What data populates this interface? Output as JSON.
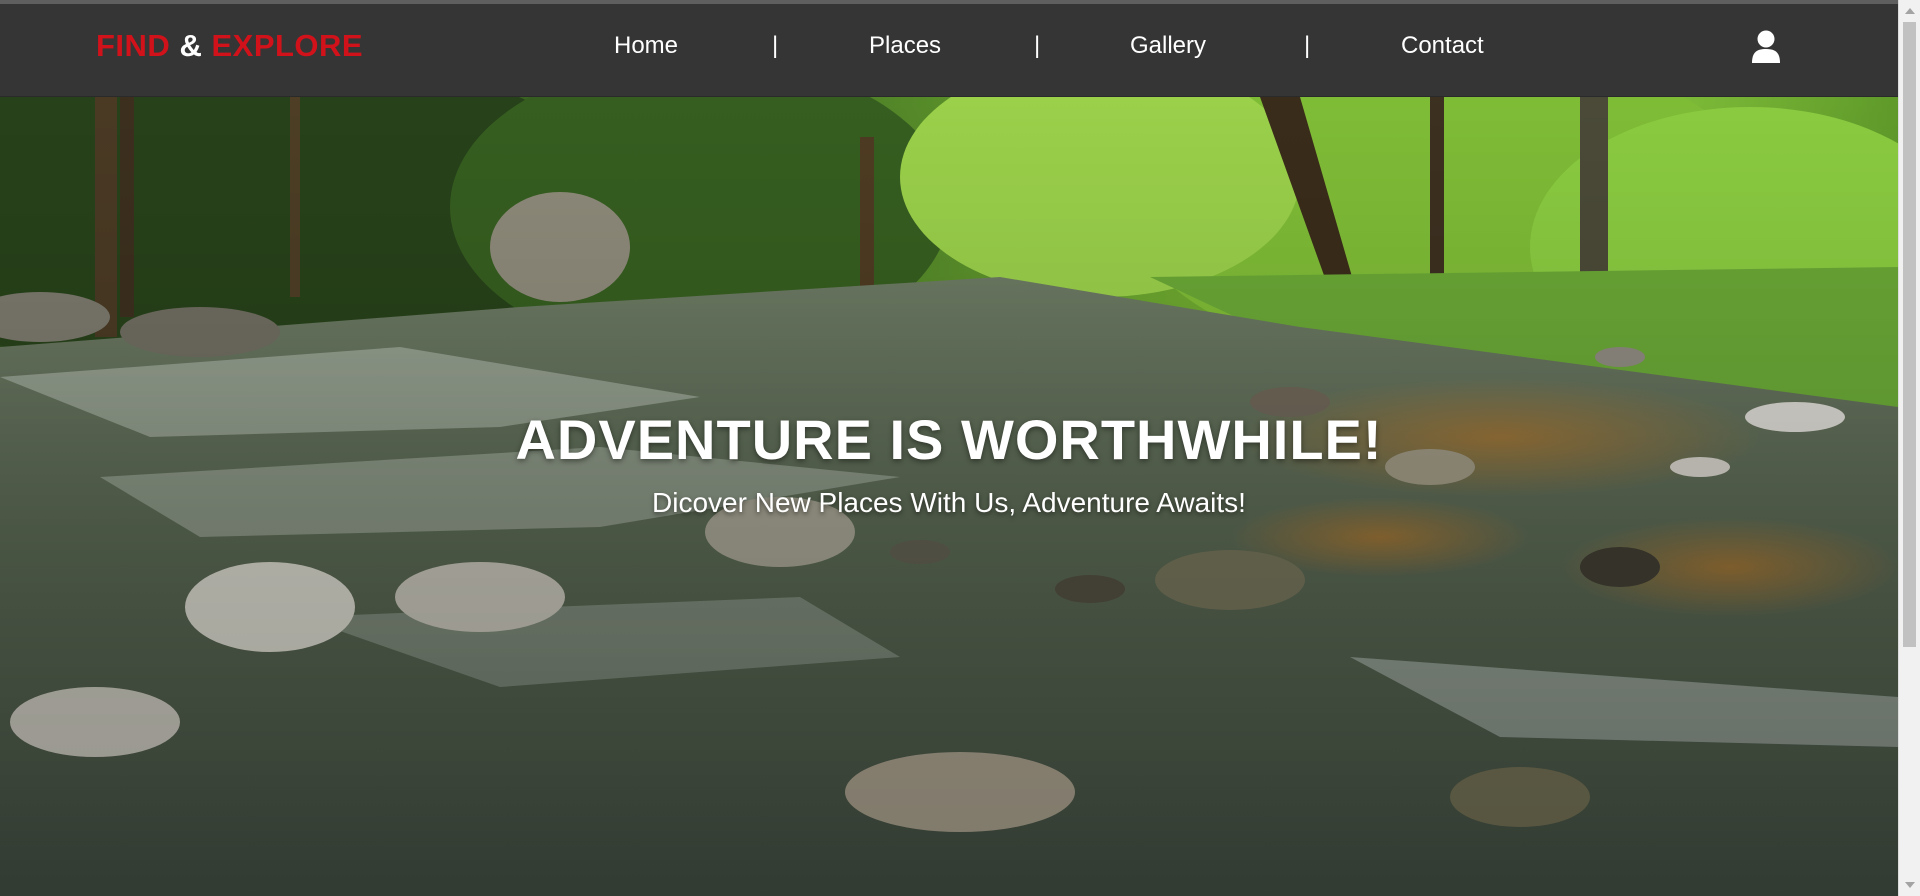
{
  "brand": {
    "part1": "FIND",
    "amp": "&",
    "part2": "EXPLORE",
    "accent_color": "#d2121a"
  },
  "nav": {
    "items": [
      {
        "label": "Home"
      },
      {
        "label": "Places"
      },
      {
        "label": "Gallery"
      },
      {
        "label": "Contact"
      }
    ],
    "separator": "|",
    "user_icon": "user-icon",
    "background": "#353535"
  },
  "hero": {
    "title": "ADVENTURE IS WORTHWHILE!",
    "subtitle": "Dicover New Places With Us, Adventure Awaits!",
    "background_image": "forest-river-image"
  },
  "scrollbar": {
    "arrow_up": "scroll-up-arrow-icon",
    "arrow_down": "scroll-down-arrow-icon"
  }
}
